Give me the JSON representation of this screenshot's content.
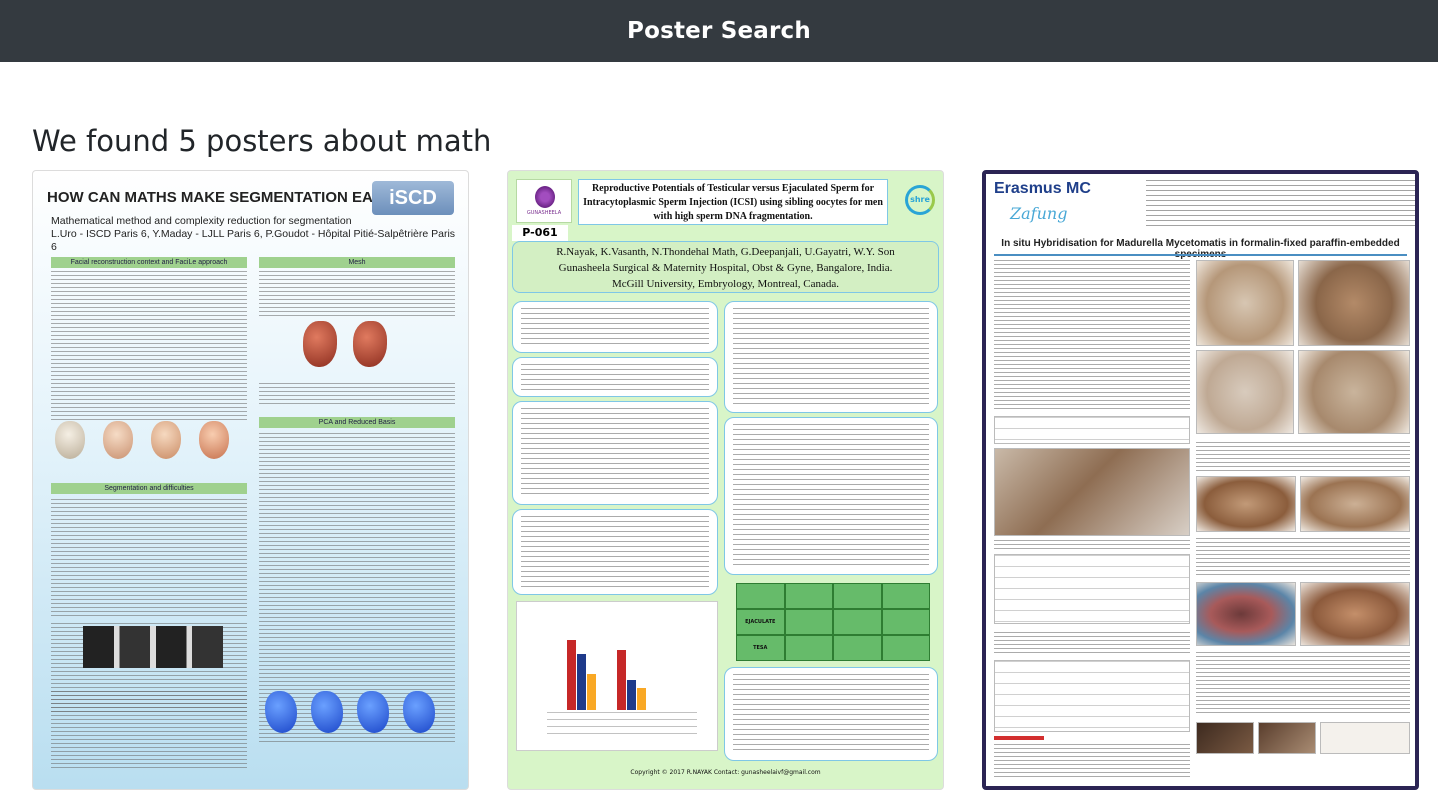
{
  "navbar": {
    "title": "Poster Search"
  },
  "results": {
    "heading": "We found 5 posters about math"
  },
  "posters": [
    {
      "title": "HOW CAN MATHS MAKE SEGMENTATION EASIER ?",
      "logo": "iSCD",
      "subtitle": "Mathematical method and complexity reduction for segmentation",
      "authors": "L.Uro - ISCD Paris 6, Y.Maday - LJLL Paris 6, P.Goudot - Hôpital Pitié-Salpêtrière Paris 6",
      "sections": [
        "Facial reconstruction context and FaciLe approach",
        "Mesh",
        "PCA and Reduced Basis",
        "Segmentation and difficulties"
      ]
    },
    {
      "code": "P-061",
      "logo": "GUNASHEELA",
      "partner_logo": "shre",
      "title": "Reproductive Potentials of Testicular versus Ejaculated Sperm for Intracytoplasmic Sperm Injection (ICSI) using sibling oocytes for men with high sperm DNA fragmentation.",
      "authors": "R.Nayak, K.Vasanth, N.Thondehal Math, G.Deepanjali, U.Gayatri, W.Y. Son",
      "affiliation": "Gunasheela Surgical & Maternity Hospital, Obst & Gyne, Bangalore, India.",
      "affiliation2": "McGill University, Embryology, Montreal, Canada.",
      "table_rows": [
        "EJACULATE",
        "TESA"
      ],
      "footer": "Copyright © 2017 R.NAYAK Contact: gunasheelaivf@gmail.com"
    },
    {
      "logo": "Erasmus MC",
      "script": "Zafung",
      "title": "In situ Hybridisation for Madurella Mycetomatis in formalin-fixed paraffin-embedded specimens"
    }
  ]
}
